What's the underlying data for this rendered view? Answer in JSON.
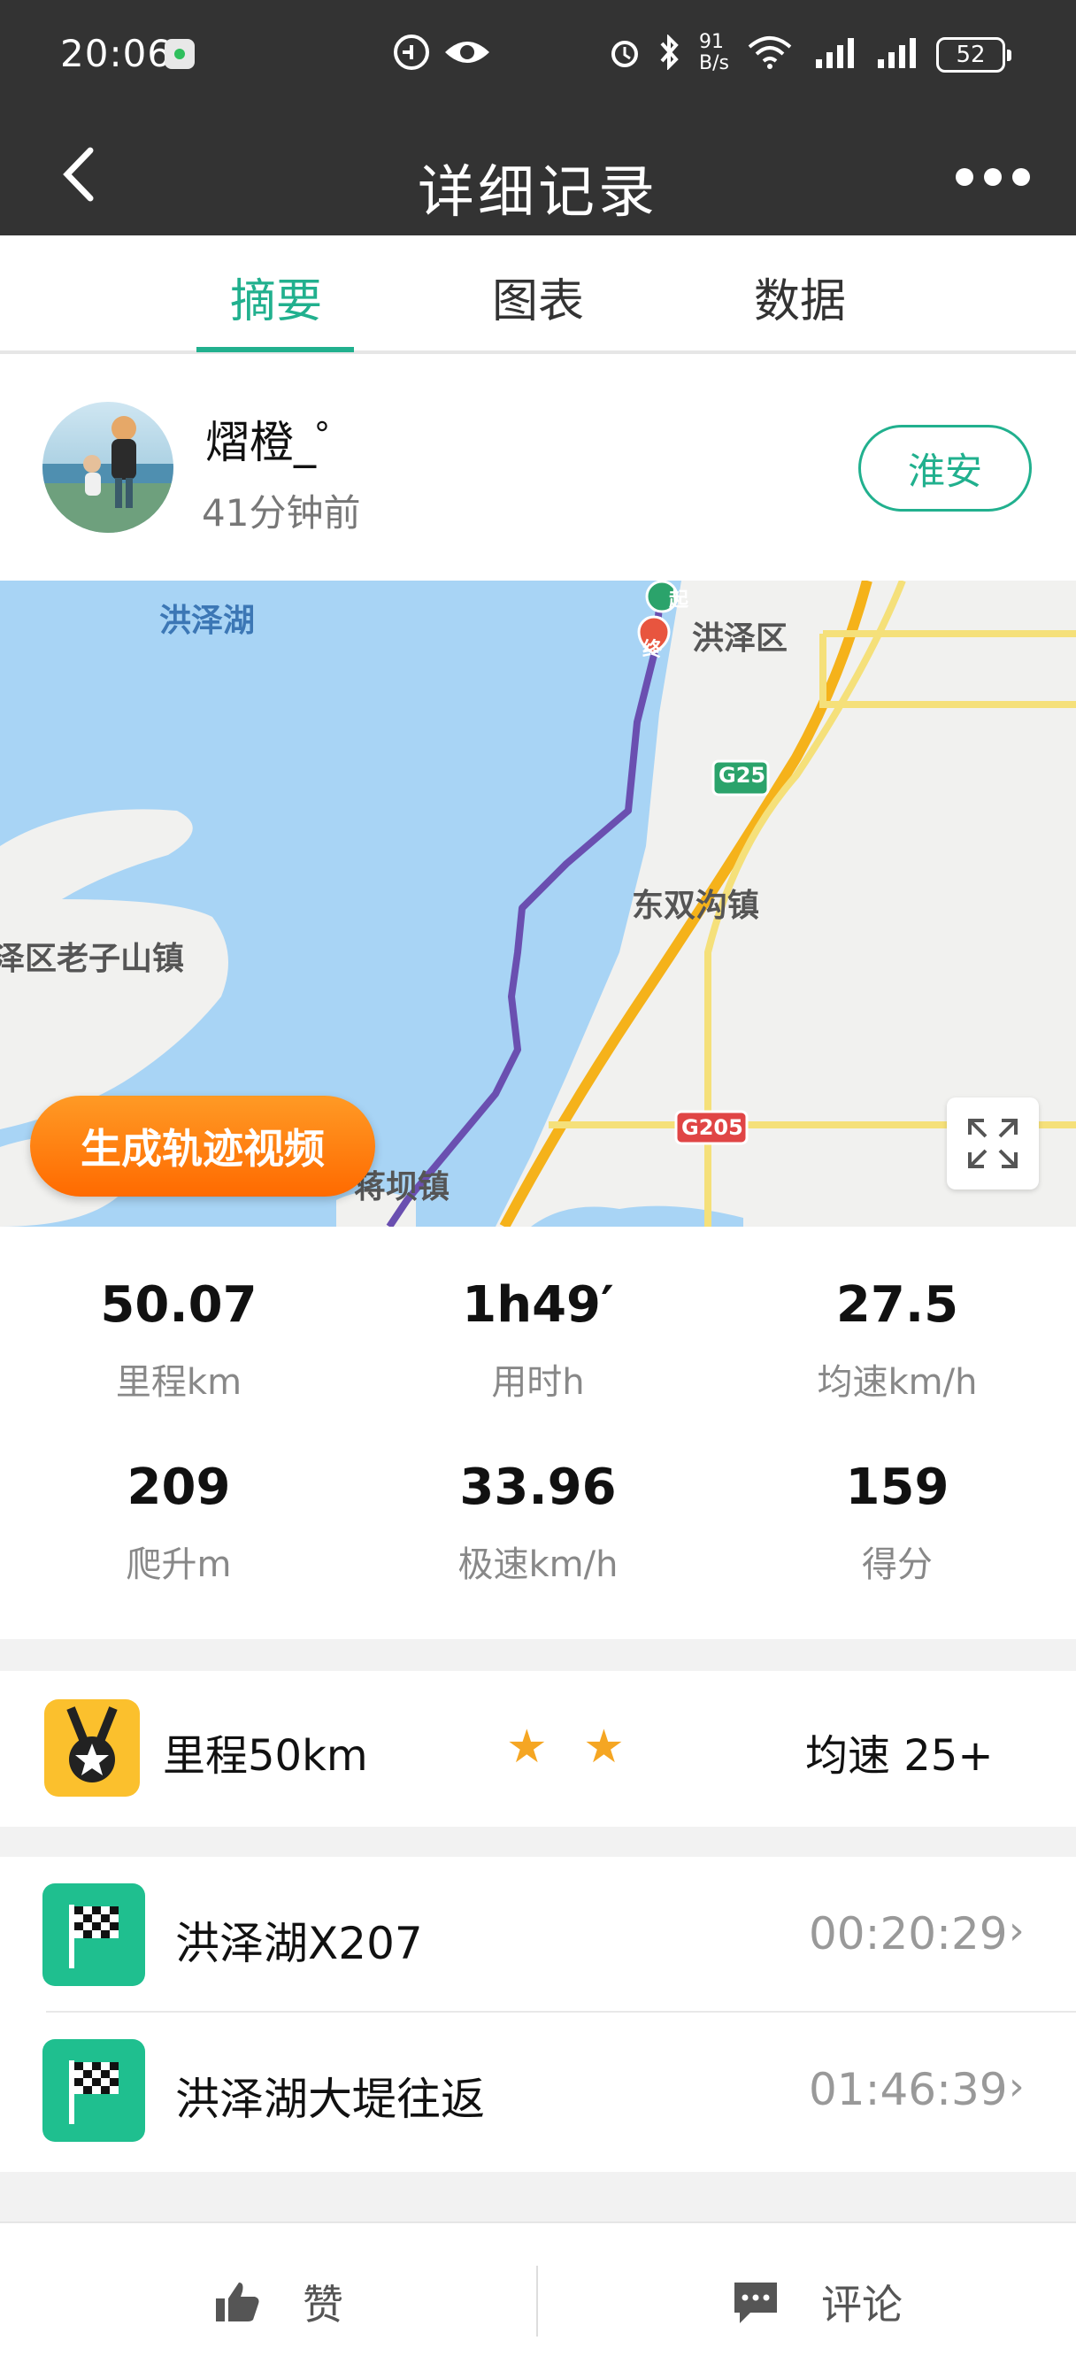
{
  "status_bar": {
    "time": "20:06",
    "net_speed_top": "91",
    "net_speed_bottom": "B/s",
    "battery": "52"
  },
  "header": {
    "title": "详细记录"
  },
  "tabs": [
    {
      "label": "摘要",
      "active": true
    },
    {
      "label": "图表",
      "active": false
    },
    {
      "label": "数据",
      "active": false
    }
  ],
  "user": {
    "name": "熠橙_゜",
    "time_ago": "41分钟前",
    "location_button": "淮安"
  },
  "map": {
    "labels": {
      "lake": "洪泽湖",
      "district": "洪泽区",
      "town1": "东双沟镇",
      "town2": "泽区老子山镇",
      "town3": "蒋坝镇",
      "road1": "G25",
      "road2": "G205",
      "start_marker": "起",
      "end_marker": "终"
    },
    "generate_button": "生成轨迹视频"
  },
  "stats": [
    {
      "value": "50.07",
      "label": "里程km"
    },
    {
      "value": "1h49′",
      "label": "用时h"
    },
    {
      "value": "27.5",
      "label": "均速km/h"
    },
    {
      "value": "209",
      "label": "爬升m"
    },
    {
      "value": "33.96",
      "label": "极速km/h"
    },
    {
      "value": "159",
      "label": "得分"
    }
  ],
  "badge": {
    "title": "里程50km",
    "stars": "★ ★",
    "speed": "均速 25+"
  },
  "segments": [
    {
      "name": "洪泽湖X207",
      "time": "00:20:29"
    },
    {
      "name": "洪泽湖大堤往返",
      "time": "01:46:39"
    }
  ],
  "bottom_bar": {
    "like": "赞",
    "comment": "评论"
  },
  "colors": {
    "accent": "#21b08e",
    "header_bg": "#333333",
    "orange": "#ff7a10"
  }
}
